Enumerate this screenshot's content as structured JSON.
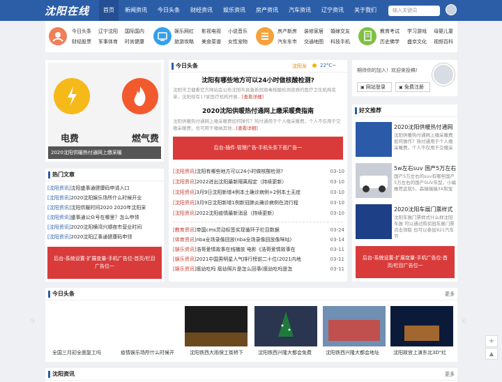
{
  "header": {
    "logo": "沈阳在线",
    "nav": [
      "首页",
      "新闻资讯",
      "今日头条",
      "财经资讯",
      "娱乐资讯",
      "房产资讯",
      "汽车资讯",
      "辽宁资讯",
      "关于我们"
    ],
    "search_placeholder": "输入关键词"
  },
  "categories": [
    {
      "icon": "user-circle-icon",
      "color": "#f07f5a",
      "links": [
        "今日头条",
        "辽宁沈阳",
        "国际国内",
        "财经股票",
        "军事体育",
        "时尚健康"
      ]
    },
    {
      "icon": "tv-icon",
      "color": "#36a0e8",
      "links": [
        "娱乐网红",
        "影视电视",
        "小说音乐",
        "旅游攻略",
        "美食菜谱",
        "女性宠物"
      ]
    },
    {
      "icon": "list-icon",
      "color": "#f5a23c",
      "links": [
        "房产新房",
        "装修家居",
        "婚嫁交友",
        "汽车车市",
        "交通地图",
        "科技手机"
      ]
    },
    {
      "icon": "doc-icon",
      "color": "#7ec142",
      "links": [
        "教育考试",
        "学习游戏",
        "母婴儿童",
        "历史佛学",
        "盛京文化",
        "视频百科"
      ]
    }
  ],
  "left": {
    "banner_caption": "2020沈阳供暖热付通网上缴采暖",
    "banner_text_1": "电费",
    "banner_text_2": "燃气费",
    "hot_title": "热门文章",
    "hot_list": [
      {
        "tag": "[沈阳资讯]",
        "text": "沈阳盛事通健康码申请入口"
      },
      {
        "tag": "[沈阳资讯]",
        "text": "2020沈阳娱乐场所什么时候开业"
      },
      {
        "tag": "[沈阳资讯]",
        "text": "沈阳供暖时间2020 2020年沈阳采"
      },
      {
        "tag": "[沈阳资讯]",
        "text": "盛事通公众号在哪里？怎么申领"
      },
      {
        "tag": "[沈阳资讯]",
        "text": "2020沈阳横湾兴顺夜市营业时间"
      },
      {
        "tag": "[沈阳资讯]",
        "text": "2020沈阳辽事通健康码申领"
      }
    ],
    "ad": "后台-系统设置-扩展变量-手机广告位-首页/栏目广告位一"
  },
  "center": {
    "title": "今日头条",
    "weather_city": "沈阳",
    "weather_label": "龙",
    "weather_temp": "22°C~",
    "headline1": "沈阳有哪些地方可以24小时做核酸检测?",
    "summary1": "沈阳市卫健委官方网站会公布沈阳市具备新冠病毒核酸检测资质的医疗卫生机构名单，沈阳现有17家医疗机构开展...",
    "more1": "[查看详细]",
    "headline2": "2020沈阳供暖热付通网上缴采暖费指南",
    "summary2": "沈阳供暖热付通网上缴采暖费如何操作？热付通用于个人缴采暖费，个人不仅用于交缴采暖费，也可用于缴纳其他...",
    "more2": "[查看详细]",
    "ad": "后台-插件-管理广告-手机头条下面广告一",
    "list1": [
      {
        "tag": "[沈阳资讯]",
        "text": "沈阳有哪些地方可以24小时做核酸检测?",
        "date": "03-10"
      },
      {
        "tag": "[沈阳资讯]",
        "text": "2022进出沈阳最新隔离规定（持续更新）",
        "date": "03-10"
      },
      {
        "tag": "[沈阳资讯]",
        "text": "3月9日沈阳新增4例本土确诊病例+2例本土无症",
        "date": "03-10"
      },
      {
        "tag": "[沈阳资讯]",
        "text": "3月9日沈阳新增1例新冠肺炎确诊病例在流行程",
        "date": "03-10"
      },
      {
        "tag": "[沈阳资讯]",
        "text": "2022沈阳疫情最新消息（持续更新）",
        "date": "03-10"
      }
    ],
    "list2": [
      {
        "tag": "[教育资讯]",
        "text": "帝国cms灵动标签实现循环子栏目数据",
        "date": "03-24"
      },
      {
        "tag": "[体育资讯]",
        "text": "nba全场录像回放(nba全场录像回放像咪咕)",
        "date": "03-14"
      },
      {
        "tag": "[娱乐资讯]",
        "text": "浩哥爱情故事在线播放 电影《浩哥爱情故事在",
        "date": "03-11"
      },
      {
        "tag": "[娱乐资讯]",
        "text": "2021中国男明星人气排行榜前二十位(2021内地",
        "date": "03-11"
      },
      {
        "tag": "[娱乐资讯]",
        "text": "瘩幼吃吗 瘩幼照片是怎么回事(瘩幼吃吗是怎",
        "date": "03-11"
      }
    ]
  },
  "right": {
    "welcome": "期待你的加入！欢迎来投稿!",
    "login": "网站登录",
    "register": "免费注册",
    "rec_title": "好文推荐",
    "rec": [
      {
        "title": "2020沈阳供暖热付通网",
        "text": "沈阳供暖热付通网上缴采暖费如何操作？热付通用于个人缴采暖费，个人不仅用于交缴采"
      },
      {
        "title": "5w左右suv 国产5万左右",
        "text": "国产5万左右的suv有哪些国产5万左右的国产SUV车型，小编推荐这就5、森瑞瑞瑞3X和宝"
      },
      {
        "title": "2020沈阳车展门票样式",
        "text": "沈阳车展门票样式什么样沈阳车展 可以通过购买园车展门票点击领取 也可以参加921汽车节"
      }
    ],
    "ad": "后台-系统设置-扩展变量-手机广告位-首页/栏目广告位一"
  },
  "bottom": {
    "title": "今日头条",
    "more": "更多",
    "items": [
      "全国三月初全面复工吗",
      "疫情娱乐场所什么时候开",
      "沈阳铁西大雨保工街桥下",
      "沈阳铁西兴隆大都会免费",
      "沈阳铁西兴隆大都会地址",
      "沈阳故宫上演东北3D\"红"
    ],
    "next_title": "沈阳资讯",
    "next_more": "更多"
  }
}
